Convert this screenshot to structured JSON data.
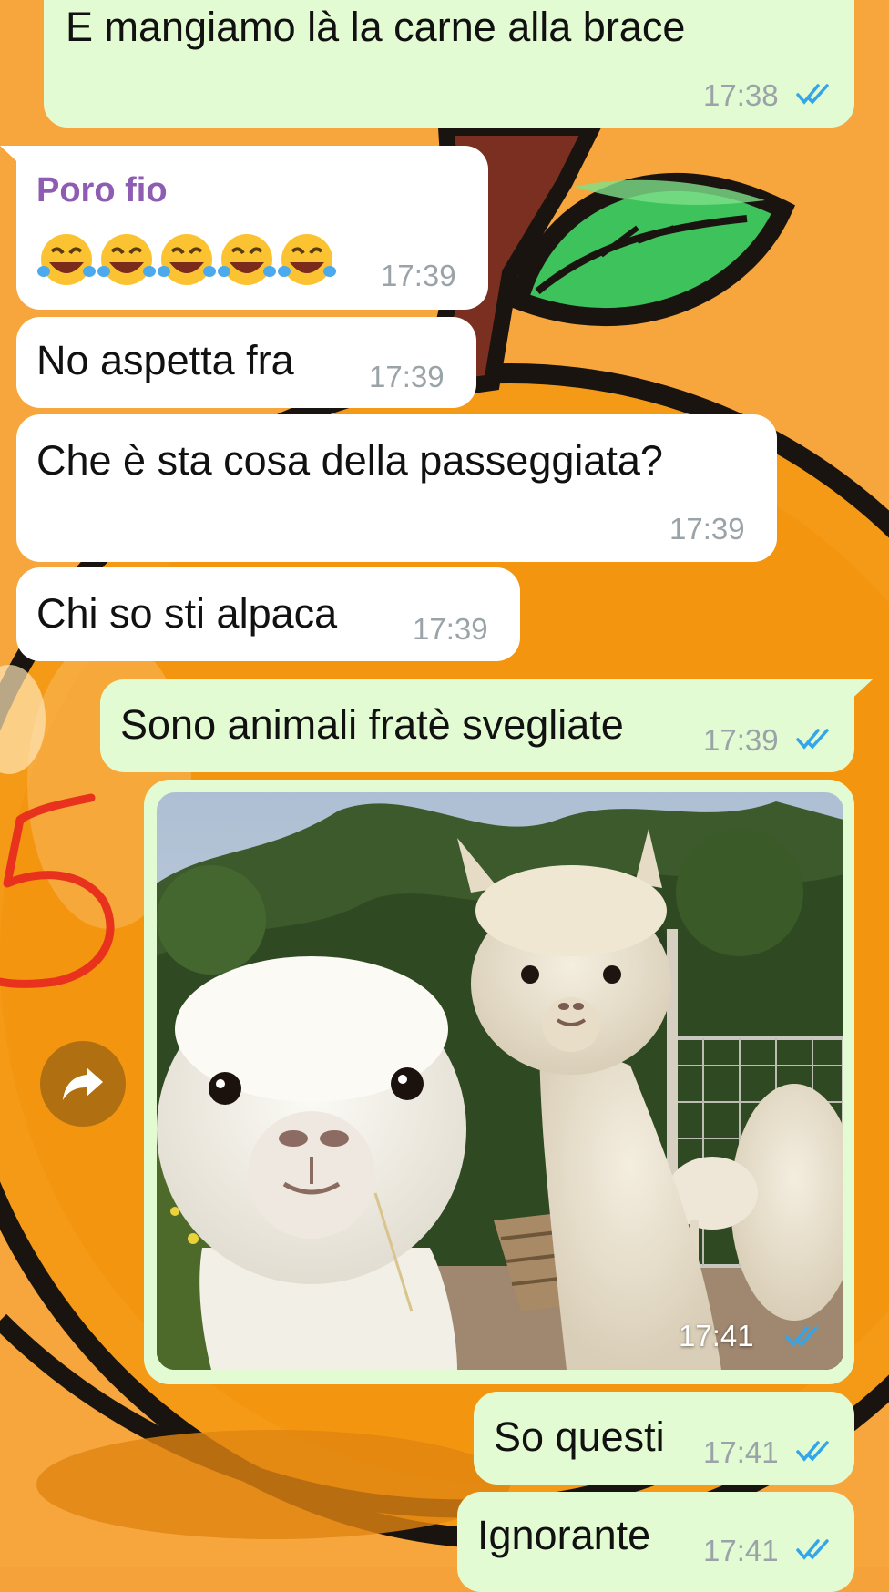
{
  "chat": {
    "messages": [
      {
        "id": "m1",
        "direction": "outgoing",
        "text": "E mangiamo là la carne alla brace",
        "time": "17:38",
        "status": "read"
      },
      {
        "id": "m2",
        "direction": "incoming",
        "sender": "Poro fio",
        "text": "😂😂😂😂😂",
        "time": "17:39"
      },
      {
        "id": "m3",
        "direction": "incoming",
        "text": "No aspetta fra",
        "time": "17:39"
      },
      {
        "id": "m4",
        "direction": "incoming",
        "text": "Che è sta cosa della passeggiata?",
        "time": "17:39"
      },
      {
        "id": "m5",
        "direction": "incoming",
        "text": "Chi so sti alpaca",
        "time": "17:39"
      },
      {
        "id": "m6",
        "direction": "outgoing",
        "text": "Sono animali fratè svegliate",
        "time": "17:39",
        "status": "read"
      },
      {
        "id": "m7",
        "direction": "outgoing",
        "type": "image",
        "image_desc_icon": "alpaca-photo",
        "time": "17:41",
        "status": "read"
      },
      {
        "id": "m8",
        "direction": "outgoing",
        "text": "So questi",
        "time": "17:41",
        "status": "read"
      },
      {
        "id": "m9",
        "direction": "outgoing",
        "text": "Ignorante",
        "time": "17:41",
        "status": "read"
      }
    ],
    "forward_icon": "forward-arrow-icon",
    "annotation_mark": "5"
  },
  "colors": {
    "outgoing_bubble": "#e3fbd2",
    "incoming_bubble": "#ffffff",
    "sender_name": "#8e5cb3",
    "read_ticks": "#34a5e8",
    "wallpaper_orange": "#f6a23a",
    "annotation_red": "#e8321e"
  }
}
